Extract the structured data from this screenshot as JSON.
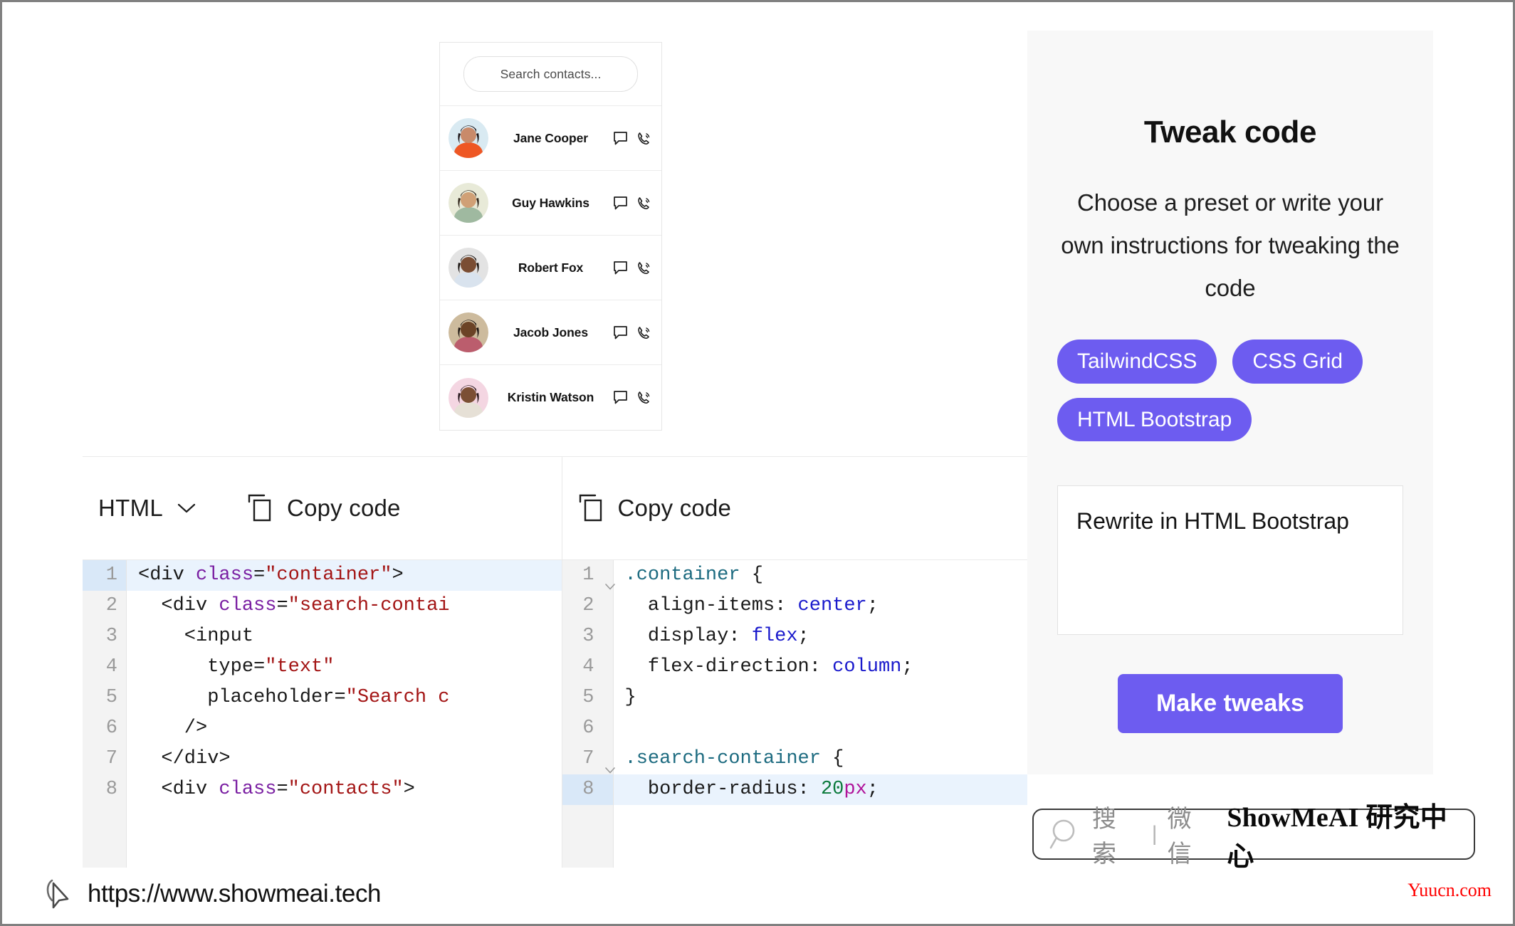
{
  "preview": {
    "search_placeholder": "Search contacts...",
    "contacts": [
      {
        "name": "Jane Cooper",
        "avatar_bg": "#d9eaf2",
        "skin": "#c98a6a",
        "hair": "#1b1417",
        "shirt": "#ee5724"
      },
      {
        "name": "Guy Hawkins",
        "avatar_bg": "#e8ead8",
        "skin": "#d0a076",
        "hair": "#2e2318",
        "shirt": "#9fb9a0"
      },
      {
        "name": "Robert Fox",
        "avatar_bg": "#e3e3e3",
        "skin": "#7a4d33",
        "hair": "#17110d",
        "shirt": "#d9e3ee"
      },
      {
        "name": "Jacob Jones",
        "avatar_bg": "#cdbb9d",
        "skin": "#6b4326",
        "hair": "#1a1310",
        "shirt": "#bb5d6d"
      },
      {
        "name": "Kristin Watson",
        "avatar_bg": "#f4d6e2",
        "skin": "#7b4f34",
        "hair": "#241419",
        "shirt": "#e6e0d6"
      }
    ],
    "message_icon": "message-bubble-icon",
    "call_icon": "phone-call-icon"
  },
  "editor": {
    "html_pane": {
      "language_label": "HTML",
      "dropdown_icon": "chevron-down-icon",
      "copy_label": "Copy code",
      "copy_icon": "copy-icon",
      "highlighted_line": 1,
      "lines": [
        {
          "n": "1",
          "tokens": [
            {
              "t": "<div ",
              "c": "t-tag"
            },
            {
              "t": "class",
              "c": "t-attr"
            },
            {
              "t": "=",
              "c": "t-plain"
            },
            {
              "t": "\"container\"",
              "c": "t-str"
            },
            {
              "t": ">",
              "c": "t-tag"
            }
          ]
        },
        {
          "n": "2",
          "tokens": [
            {
              "t": "  <div ",
              "c": "t-tag"
            },
            {
              "t": "class",
              "c": "t-attr"
            },
            {
              "t": "=",
              "c": "t-plain"
            },
            {
              "t": "\"search-contai",
              "c": "t-str"
            }
          ]
        },
        {
          "n": "3",
          "tokens": [
            {
              "t": "    <input",
              "c": "t-tag"
            }
          ]
        },
        {
          "n": "4",
          "tokens": [
            {
              "t": "      type",
              "c": "t-plain"
            },
            {
              "t": "=",
              "c": "t-plain"
            },
            {
              "t": "\"text\"",
              "c": "t-str"
            }
          ]
        },
        {
          "n": "5",
          "tokens": [
            {
              "t": "      placeholder",
              "c": "t-plain"
            },
            {
              "t": "=",
              "c": "t-plain"
            },
            {
              "t": "\"Search c",
              "c": "t-str"
            }
          ]
        },
        {
          "n": "6",
          "tokens": [
            {
              "t": "    />",
              "c": "t-tag"
            }
          ]
        },
        {
          "n": "7",
          "tokens": [
            {
              "t": "  </div>",
              "c": "t-tag"
            }
          ]
        },
        {
          "n": "8",
          "tokens": [
            {
              "t": "  <div ",
              "c": "t-tag"
            },
            {
              "t": "class",
              "c": "t-attr"
            },
            {
              "t": "=",
              "c": "t-plain"
            },
            {
              "t": "\"contacts\"",
              "c": "t-str"
            },
            {
              "t": ">",
              "c": "t-tag"
            }
          ]
        }
      ]
    },
    "css_pane": {
      "copy_label": "Copy code",
      "copy_icon": "copy-icon",
      "highlighted_line": 8,
      "fold_lines": [
        "1",
        "7"
      ],
      "lines": [
        {
          "n": "1",
          "tokens": [
            {
              "t": ".container ",
              "c": "t-sel"
            },
            {
              "t": "{",
              "c": "t-plain"
            }
          ]
        },
        {
          "n": "2",
          "tokens": [
            {
              "t": "  align-items: ",
              "c": "t-prop"
            },
            {
              "t": "center",
              "c": "t-val"
            },
            {
              "t": ";",
              "c": "t-plain"
            }
          ]
        },
        {
          "n": "3",
          "tokens": [
            {
              "t": "  display: ",
              "c": "t-prop"
            },
            {
              "t": "flex",
              "c": "t-val"
            },
            {
              "t": ";",
              "c": "t-plain"
            }
          ]
        },
        {
          "n": "4",
          "tokens": [
            {
              "t": "  flex-direction: ",
              "c": "t-prop"
            },
            {
              "t": "column",
              "c": "t-val"
            },
            {
              "t": ";",
              "c": "t-plain"
            }
          ]
        },
        {
          "n": "5",
          "tokens": [
            {
              "t": "}",
              "c": "t-plain"
            }
          ]
        },
        {
          "n": "6",
          "tokens": [
            {
              "t": "",
              "c": "t-plain"
            }
          ]
        },
        {
          "n": "7",
          "tokens": [
            {
              "t": ".search-container ",
              "c": "t-sel"
            },
            {
              "t": "{",
              "c": "t-plain"
            }
          ]
        },
        {
          "n": "8",
          "tokens": [
            {
              "t": "  border-radius: ",
              "c": "t-prop"
            },
            {
              "t": "20",
              "c": "t-num"
            },
            {
              "t": "px",
              "c": "t-unit"
            },
            {
              "t": ";",
              "c": "t-plain"
            }
          ]
        }
      ]
    }
  },
  "tweak": {
    "title": "Tweak code",
    "subtitle": "Choose a preset or write your own instructions for tweaking the code",
    "presets": [
      "TailwindCSS",
      "CSS Grid",
      "HTML Bootstrap"
    ],
    "instruction_value": "Rewrite in HTML Bootstrap",
    "instruction_placeholder": "",
    "submit_label": "Make tweaks",
    "accent_color": "#6d5cf0"
  },
  "watermark": {
    "search_icon": "magnifier-icon",
    "search_text": "搜索",
    "divider": "|",
    "channel": "微信",
    "brand": "ShowMeAI 研究中心"
  },
  "footer": {
    "cursor_icon": "cursor-arrow-icon",
    "url": "https://www.showmeai.tech",
    "credit": "Yuucn.com",
    "credit_color": "#ff0000"
  }
}
